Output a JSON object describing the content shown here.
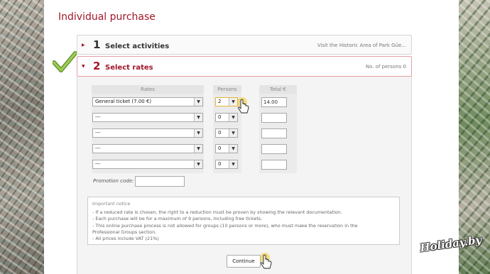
{
  "page": {
    "title": "Individual purchase"
  },
  "steps": [
    {
      "number": "1",
      "label": "Select activities",
      "right_text": "Visit the Historic Area of Park Güe..."
    },
    {
      "number": "2",
      "label": "Select rates",
      "right_text": "No. of persons 0"
    }
  ],
  "table": {
    "headers": {
      "rates": "Rates",
      "persons": "Persons",
      "total": "Total €"
    },
    "rows": [
      {
        "rate": "General ticket (7.00 €)",
        "persons": "2",
        "total": "14.00"
      },
      {
        "rate": "---",
        "persons": "0",
        "total": ""
      },
      {
        "rate": "---",
        "persons": "0",
        "total": ""
      },
      {
        "rate": "---",
        "persons": "0",
        "total": ""
      },
      {
        "rate": "---",
        "persons": "0",
        "total": ""
      }
    ]
  },
  "promotion": {
    "label": "Promotion code:",
    "value": ""
  },
  "notice": {
    "title": "Important notice",
    "lines": [
      "- If a reduced rate is chosen, the right to a reduction must be proven by showing the relevant documentation.",
      "- Each purchase will be for a maximum of 9 persons, including free tickets.",
      "- This online purchase process is not allowed for groups (10 persons or more), who must make the reservation in the",
      "Professional Groups section.",
      "- All prices include VAT (21%)"
    ]
  },
  "continue_label": "Continue",
  "watermark": "Holiday.by",
  "colors": {
    "accent": "#a0172a",
    "check": "#8bc34a",
    "cursor_glow": "#f3c623"
  }
}
